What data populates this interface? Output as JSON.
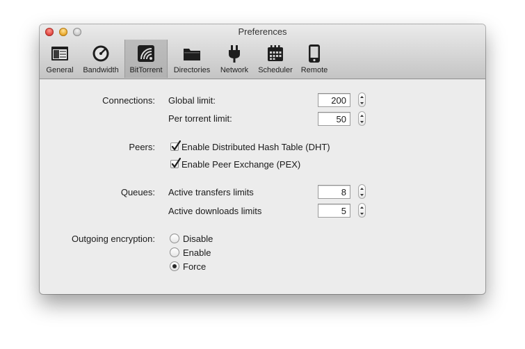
{
  "window": {
    "title": "Preferences"
  },
  "toolbar": {
    "tabs": [
      {
        "label": "General",
        "icon": "general-window-icon"
      },
      {
        "label": "Bandwidth",
        "icon": "gauge-icon"
      },
      {
        "label": "BitTorrent",
        "icon": "bittorrent-icon",
        "selected": true
      },
      {
        "label": "Directories",
        "icon": "folder-icon"
      },
      {
        "label": "Network",
        "icon": "plug-icon"
      },
      {
        "label": "Scheduler",
        "icon": "calendar-icon"
      },
      {
        "label": "Remote",
        "icon": "device-icon"
      }
    ]
  },
  "connections": {
    "section_label": "Connections:",
    "global_limit_label": "Global limit:",
    "global_limit_value": "200",
    "per_torrent_label": "Per torrent limit:",
    "per_torrent_value": "50"
  },
  "peers": {
    "section_label": "Peers:",
    "dht_label": "Enable Distributed Hash Table (DHT)",
    "dht_checked": true,
    "pex_label": "Enable Peer Exchange (PEX)",
    "pex_checked": true
  },
  "queues": {
    "section_label": "Queues:",
    "active_transfers_label": "Active transfers limits",
    "active_transfers_value": "8",
    "active_downloads_label": "Active downloads limits",
    "active_downloads_value": "5"
  },
  "encryption": {
    "section_label": "Outgoing encryption:",
    "options": [
      "Disable",
      "Enable",
      "Force"
    ],
    "selected": "Force"
  }
}
